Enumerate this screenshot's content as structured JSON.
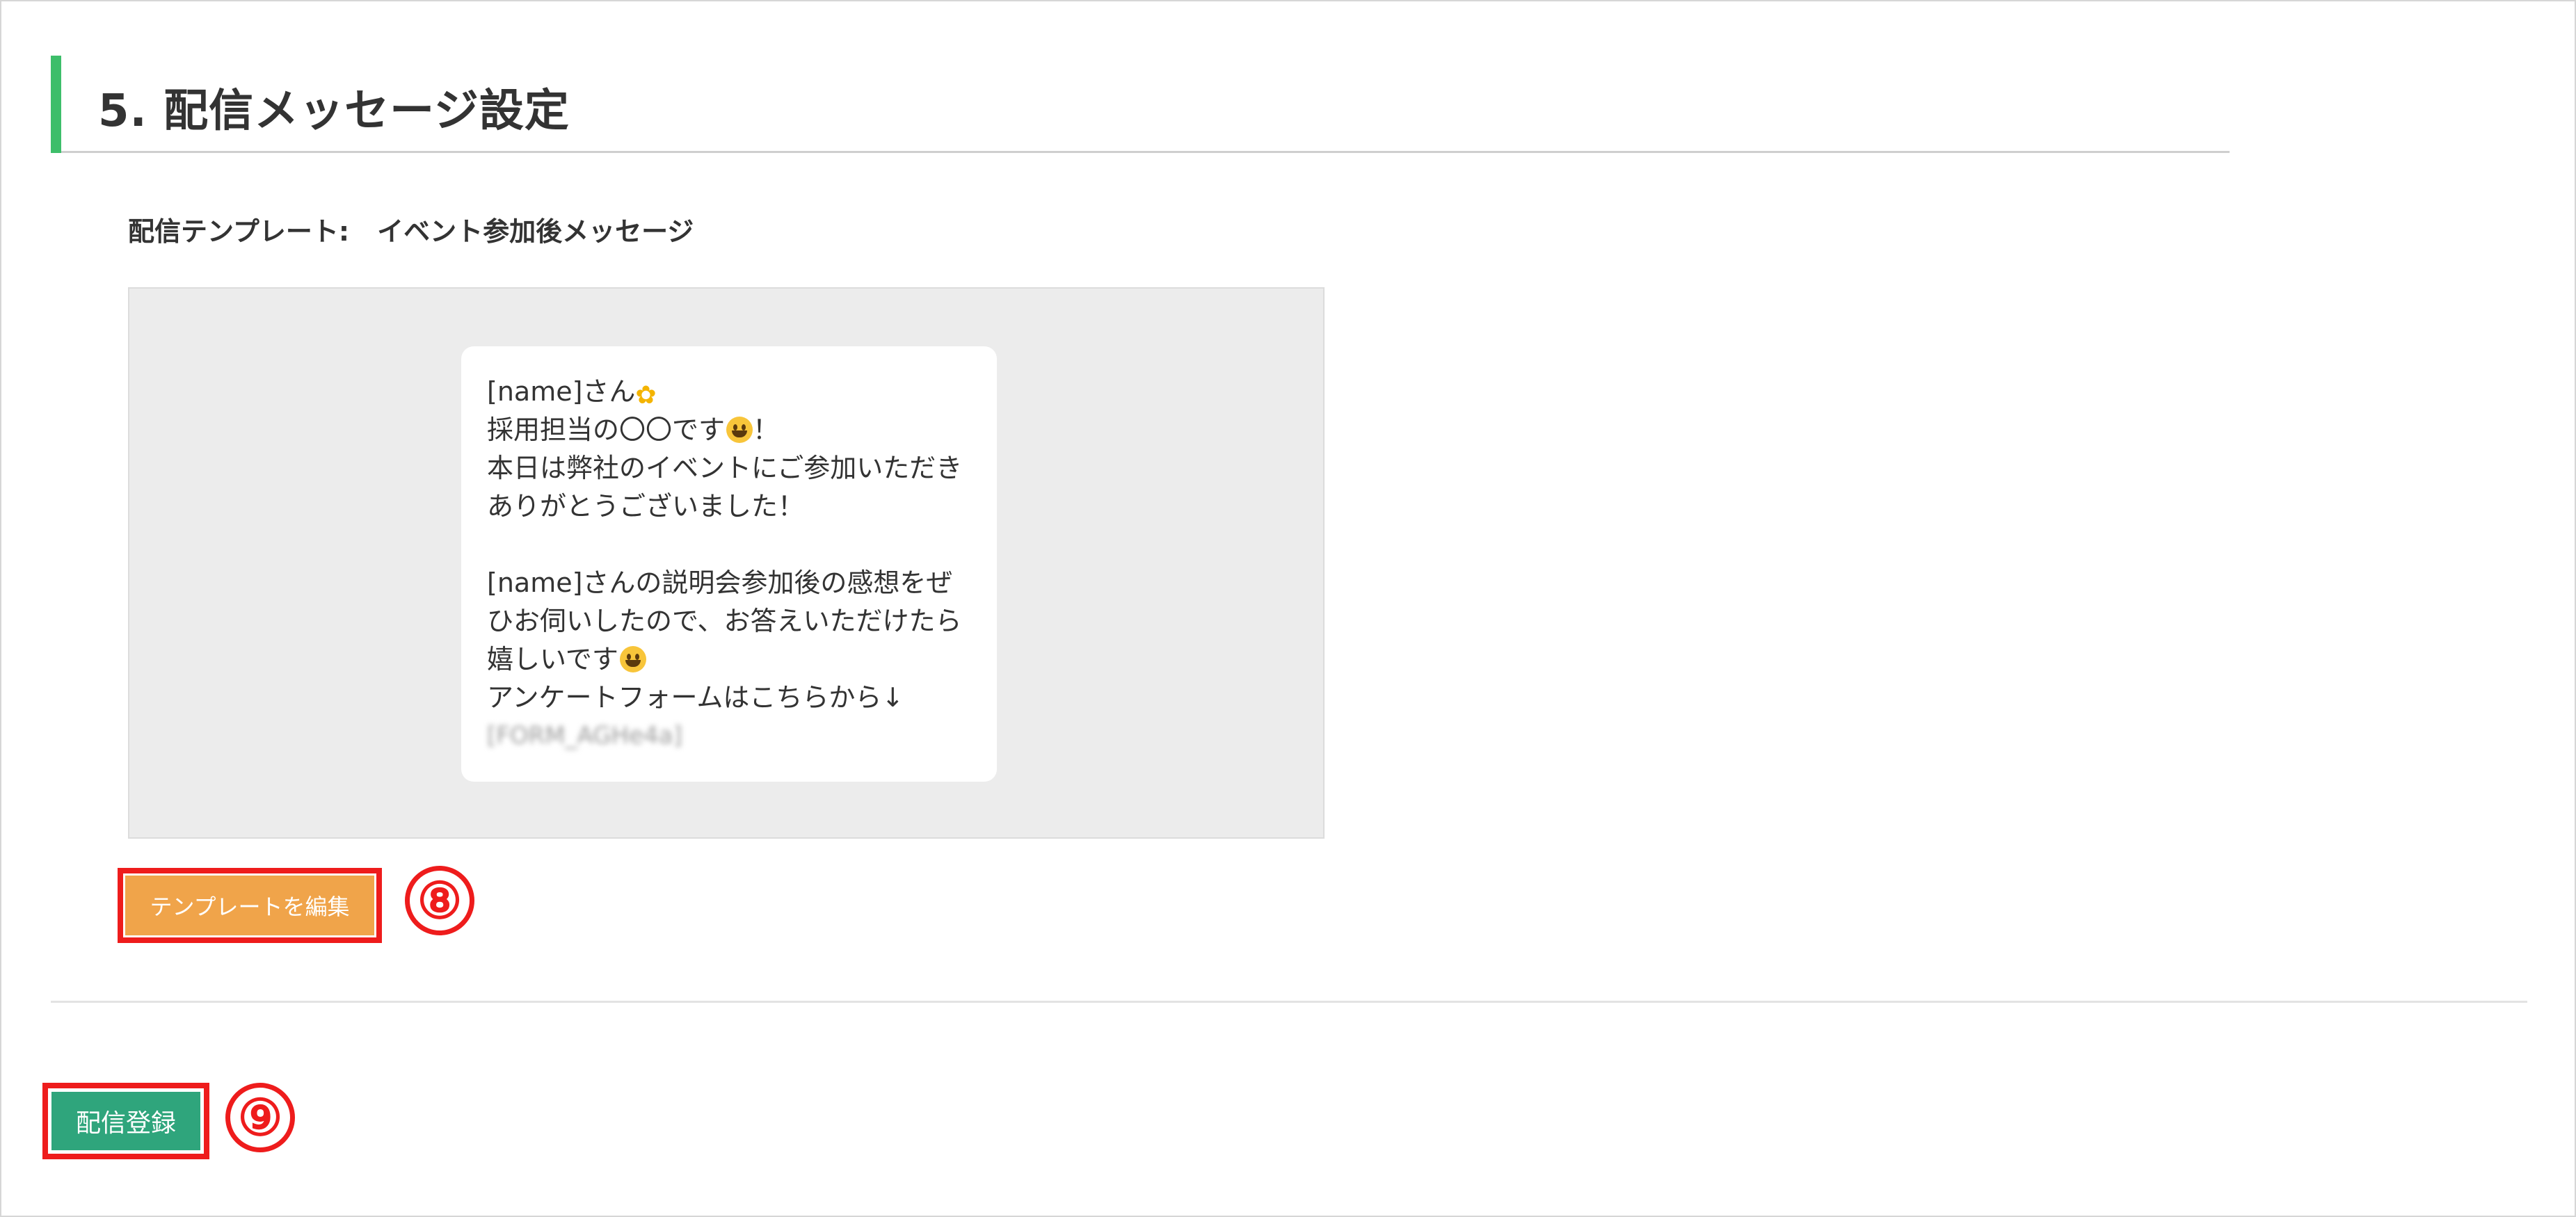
{
  "section": {
    "title": "5. 配信メッセージ設定",
    "accent_color": "#3dbe6a"
  },
  "template": {
    "label": "配信テンプレート:",
    "name": "イベント参加後メッセージ"
  },
  "message": {
    "line1_name": "[name]さん",
    "line1_emoji": "flower-emoji",
    "line2_text": "採用担当の〇〇です",
    "line2_emoji": "grinning-face-emoji",
    "line2_suffix": "！",
    "line3": "本日は弊社のイベントにご参加いただき",
    "line4": "ありがとうございました！",
    "line5": "[name]さんの説明会参加後の感想をぜ",
    "line6": "ひお伺いしたので、お答えいただけたら",
    "line7_text": "嬉しいです",
    "line7_emoji": "grinning-face-emoji",
    "line8": "アンケートフォームはこちらから↓",
    "line9_blurred": "[FORM_AGHe4a]"
  },
  "buttons": {
    "edit_template": "テンプレートを編集",
    "register": "配信登録"
  },
  "annotations": {
    "step_8": "⑧",
    "step_9": "⑨",
    "highlight_color": "#ee1c1c"
  },
  "colors": {
    "edit_button": "#f0a44a",
    "register_button": "#2fa57c",
    "preview_background": "#ececec"
  }
}
